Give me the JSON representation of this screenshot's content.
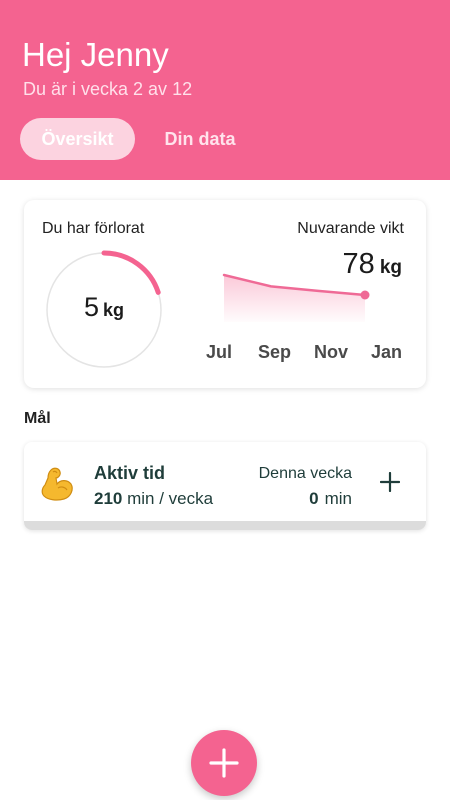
{
  "header": {
    "greeting": "Hej Jenny",
    "subtitle": "Du är i vecka 2 av 12",
    "tabs": [
      {
        "label": "Översikt",
        "active": true
      },
      {
        "label": "Din data",
        "active": false
      }
    ]
  },
  "weight_card": {
    "lost_label": "Du har förlorat",
    "lost_value": "5",
    "lost_unit": "kg",
    "lost_progress_fraction": 0.2,
    "current_label": "Nuvarande vikt",
    "current_value": "78",
    "current_unit": "kg",
    "months": [
      "Jul",
      "Sep",
      "Nov",
      "Jan"
    ],
    "trend": [
      83,
      80.5,
      79.5,
      78.6
    ]
  },
  "goals": {
    "heading": "Mål",
    "items": [
      {
        "icon": "flexed-biceps-icon",
        "title": "Aktiv tid",
        "target_value": "210",
        "target_unit": "min / vecka",
        "week_label": "Denna vecka",
        "week_value": "0",
        "week_unit": "min"
      }
    ]
  },
  "colors": {
    "brand": "#f46390",
    "text_dark_green": "#1f3d3a"
  }
}
